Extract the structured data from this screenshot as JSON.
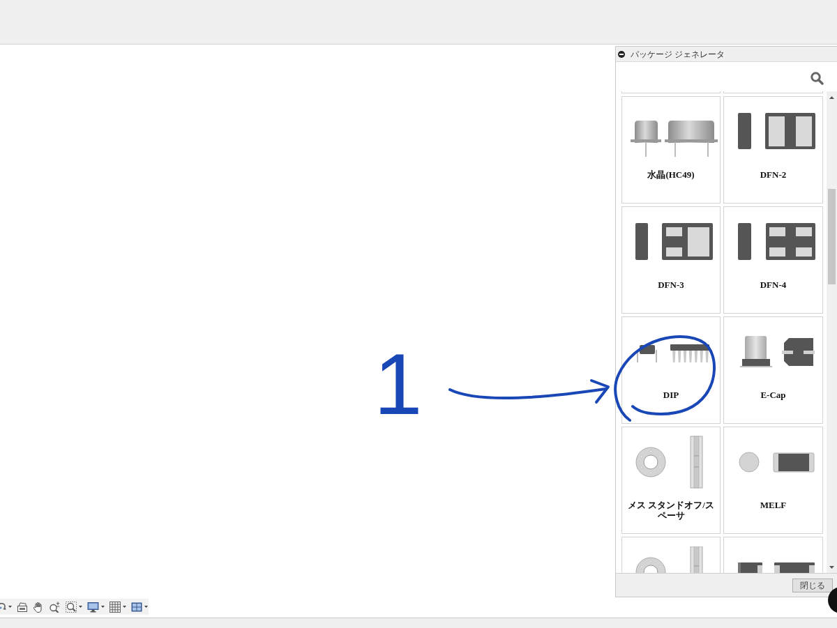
{
  "panel": {
    "title": "パッケージ ジェネレータ",
    "tiles": [
      {
        "kind": "crystal",
        "label": "水晶(HC49)"
      },
      {
        "kind": "dfn2",
        "label": "DFN-2"
      },
      {
        "kind": "dfn3",
        "label": "DFN-3"
      },
      {
        "kind": "dfn4",
        "label": "DFN-4"
      },
      {
        "kind": "dip",
        "label": "DIP"
      },
      {
        "kind": "ecap",
        "label": "E-Cap"
      },
      {
        "kind": "standoff",
        "label": "メス スタンドオフ/スペーサ"
      },
      {
        "kind": "melf",
        "label": "MELF"
      },
      {
        "kind": "standoff"
      },
      {
        "kind": "chip"
      }
    ],
    "close_button": "閉じる"
  },
  "view_toolbar": [
    {
      "kind": "orbit",
      "dropdown": true
    },
    {
      "kind": "look_at",
      "dropdown": false
    },
    {
      "kind": "pan",
      "dropdown": false
    },
    {
      "kind": "zoom",
      "dropdown": false
    },
    {
      "kind": "zoom_window",
      "dropdown": true
    },
    {
      "kind": "display",
      "dropdown": true
    },
    {
      "kind": "grid",
      "dropdown": true
    },
    {
      "kind": "viewports",
      "dropdown": true
    }
  ],
  "annotation": {
    "label": "1"
  }
}
